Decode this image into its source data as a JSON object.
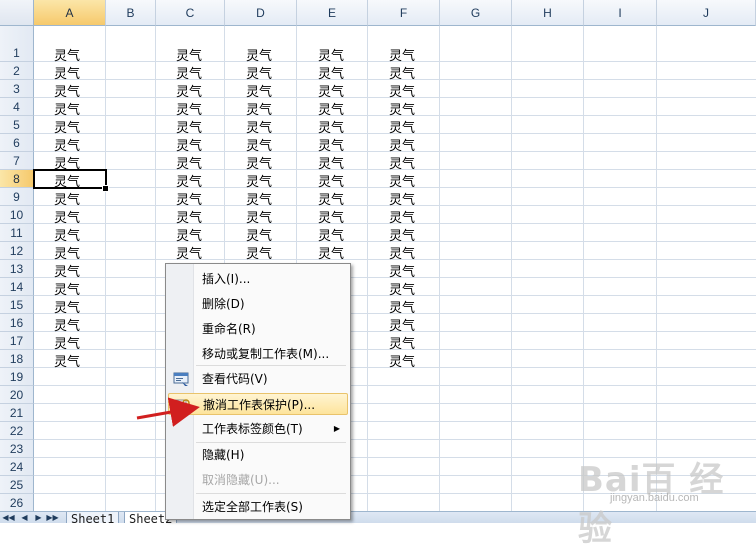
{
  "columns": [
    "A",
    "B",
    "C",
    "D",
    "E",
    "F",
    "G",
    "H",
    "I",
    "J"
  ],
  "selected_column": "A",
  "rows": [
    "1",
    "2",
    "3",
    "4",
    "5",
    "6",
    "7",
    "8",
    "9",
    "10",
    "11",
    "12",
    "13",
    "14",
    "15",
    "16",
    "17",
    "18",
    "19",
    "20",
    "21",
    "22",
    "23",
    "24",
    "25",
    "26"
  ],
  "selected_row": "8",
  "cell_text": "灵气",
  "sheet_tabs": [
    "Sheet1",
    "Sheet2"
  ],
  "active_tab": "Sheet2",
  "context_menu": [
    {
      "label": "插入(I)...",
      "icon": "",
      "enabled": true,
      "submenu": false,
      "highlighted": false
    },
    {
      "label": "删除(D)",
      "icon": "",
      "enabled": true,
      "submenu": false,
      "highlighted": false
    },
    {
      "label": "重命名(R)",
      "icon": "",
      "enabled": true,
      "submenu": false,
      "highlighted": false
    },
    {
      "label": "移动或复制工作表(M)...",
      "icon": "",
      "enabled": true,
      "submenu": false,
      "highlighted": false
    },
    {
      "label": "查看代码(V)",
      "icon": "view-code-icon",
      "enabled": true,
      "submenu": false,
      "highlighted": false
    },
    {
      "label": "撤消工作表保护(P)...",
      "icon": "unprotect-sheet-icon",
      "enabled": true,
      "submenu": false,
      "highlighted": true
    },
    {
      "label": "工作表标签颜色(T)",
      "icon": "",
      "enabled": true,
      "submenu": true,
      "highlighted": false
    },
    {
      "label": "隐藏(H)",
      "icon": "",
      "enabled": true,
      "submenu": false,
      "highlighted": false
    },
    {
      "label": "取消隐藏(U)...",
      "icon": "",
      "enabled": false,
      "submenu": false,
      "highlighted": false
    },
    {
      "label": "选定全部工作表(S)",
      "icon": "",
      "enabled": true,
      "submenu": false,
      "highlighted": false
    }
  ],
  "watermark": {
    "logo": "Bai百 经验",
    "url": "jingyan.baidu.com"
  },
  "colors": {
    "header_selected": "#f6c96c",
    "gridline": "#d4dde8",
    "menu_hover": "#fde49c",
    "annotation_arrow": "#d11f1f"
  }
}
